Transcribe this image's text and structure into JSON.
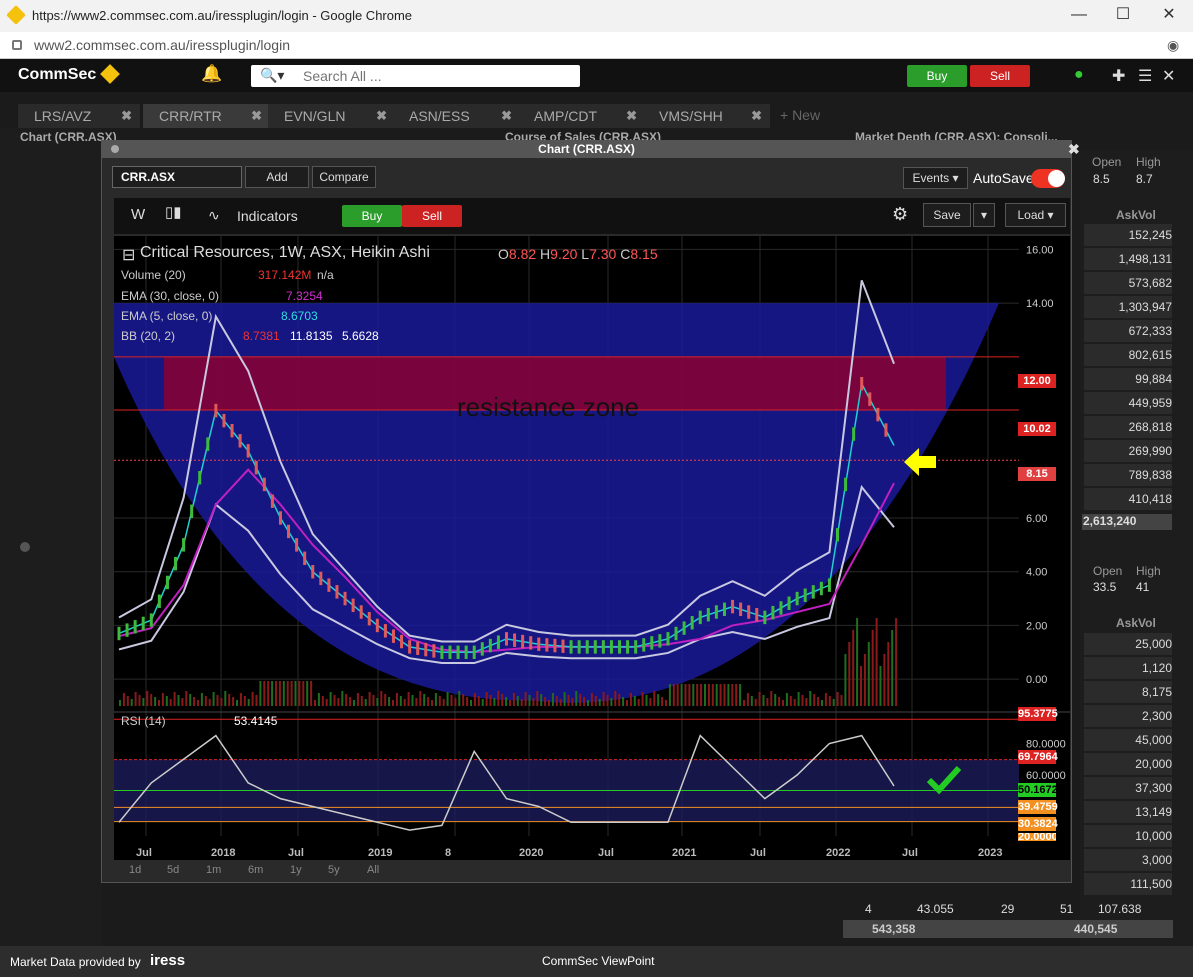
{
  "browser": {
    "title": "https://www2.commsec.com.au/iressplugin/login - Google Chrome",
    "url": "www2.commsec.com.au/iressplugin/login",
    "min_icon": "—",
    "max_icon": "☐",
    "close_icon": "✕"
  },
  "app": {
    "logo": "CommSec",
    "search_placeholder": "Search All ...",
    "buy": "Buy",
    "sell": "Sell",
    "footer_left": "Market Data provided by",
    "footer_brand": "iress",
    "footer_center": "CommSec ViewPoint"
  },
  "tabs": [
    {
      "label": "LRS/AVZ"
    },
    {
      "label": "CRR/RTR"
    },
    {
      "label": "EVN/GLN"
    },
    {
      "label": "ASN/ESS"
    },
    {
      "label": "AMP/CDT"
    },
    {
      "label": "VMS/SHH"
    }
  ],
  "new_tab": "+ New",
  "panels": {
    "chart_left": "Chart (CRR.ASX)",
    "course_of_sales": "Course of Sales (CRR.ASX)",
    "market_depth": "Market Depth (CRR.ASX): Consoli..."
  },
  "depth_top": {
    "open_label": "Open",
    "open": "8.5",
    "high_label": "High",
    "high": "8.7",
    "askvol_label": "AskVol",
    "askvols": [
      "152,245",
      "1,498,131",
      "573,682",
      "1,303,947",
      "672,333",
      "802,615",
      "99,884",
      "449,959",
      "268,818",
      "269,990",
      "789,838",
      "410,418"
    ],
    "total": "2,613,240"
  },
  "depth_bottom": {
    "open_label": "Open",
    "open": "33.5",
    "high_label": "High",
    "high": "41",
    "askvol_label": "AskVol",
    "askvols": [
      "25,000",
      "1,120",
      "8,175",
      "2,300",
      "45,000",
      "20,000",
      "37,300",
      "13,149",
      "10,000",
      "3,000",
      "111,500"
    ]
  },
  "bottom_row": {
    "a": "4",
    "b": "43.055",
    "c": "29",
    "d": "51",
    "e": "107.638",
    "f": "543,358",
    "g": "440,545"
  },
  "chart_window": {
    "title": "Chart (CRR.ASX)",
    "symbol": "CRR.ASX",
    "add": "Add",
    "compare": "Compare",
    "events": "Events ▾",
    "autosave": "AutoSave",
    "interval": "W",
    "indicators": "Indicators",
    "buy": "Buy",
    "sell": "Sell",
    "save": "Save",
    "load": "Load ▾"
  },
  "legend": {
    "title": "Critical Resources, 1W, ASX, Heikin Ashi",
    "o_label": "O",
    "o": "8.82",
    "h_label": "H",
    "h": "9.20",
    "l_label": "L",
    "l": "7.30",
    "c_label": "C",
    "c": "8.15",
    "volume": "Volume (20)",
    "volume_val": "317.142M",
    "volume_na": "n/a",
    "ema30": "EMA (30, close, 0)",
    "ema30_val": "7.3254",
    "ema5": "EMA (5, close, 0)",
    "ema5_val": "8.6703",
    "bb": "BB (20, 2)",
    "bb_v1": "8.7381",
    "bb_v2": "11.8135",
    "bb_v3": "5.6628",
    "rsi": "RSI (14)",
    "rsi_val": "53.4145"
  },
  "annotation": "resistance zone",
  "price_tags": {
    "p12": "12.00",
    "p10": "10.02",
    "p8": "8.15"
  },
  "rsi_tags": {
    "r95": "95.3775",
    "r69": "69.7964",
    "r50": "50.1672",
    "r39": "39.4759",
    "r30": "30.3824",
    "r20": "20.0000"
  },
  "periods": [
    "1d",
    "5d",
    "1m",
    "6m",
    "1y",
    "5y",
    "All"
  ],
  "colors": {
    "buy": "#2a9d2a",
    "sell": "#cc2222",
    "resistance": "#8b0030",
    "cup": "#1a1a9a",
    "ema30": "#c020c0",
    "ema5": "#20d0d0",
    "bb": "#c8c8e0",
    "up": "#3dbb3d",
    "down": "#e05a5a"
  },
  "chart_data": {
    "type": "line",
    "title": "Critical Resources, 1W, ASX, Heikin Ashi",
    "x_ticks": [
      "Jul",
      "2018",
      "Jul",
      "2019",
      "8",
      "2020",
      "Jul",
      "2021",
      "Jul",
      "2022",
      "Jul",
      "2023"
    ],
    "y_ticks": [
      0,
      2,
      4,
      6,
      14,
      16
    ],
    "ylim": [
      -1,
      16.5
    ],
    "resistance_zone": [
      10.02,
      12.0
    ],
    "last_close": 8.15,
    "series": [
      {
        "name": "EMA (30, close, 0)",
        "values": [
          1.6,
          1.9,
          3.5,
          6.5,
          7.8,
          6.5,
          5.0,
          3.8,
          2.5,
          1.5,
          1.1,
          1.0,
          1.1,
          1.2,
          1.2,
          1.2,
          1.2,
          1.3,
          1.5,
          2.0,
          2.2,
          2.5,
          2.8,
          5.0,
          7.3
        ]
      },
      {
        "name": "EMA (5, close, 0)",
        "values": [
          1.7,
          2.2,
          5.0,
          10.0,
          8.5,
          6.0,
          4.0,
          3.0,
          2.0,
          1.2,
          1.0,
          1.0,
          1.5,
          1.3,
          1.2,
          1.2,
          1.2,
          1.5,
          2.3,
          2.7,
          2.3,
          3.0,
          3.5,
          11.0,
          8.7
        ]
      },
      {
        "name": "RSI (14)",
        "values": [
          30,
          55,
          70,
          85,
          55,
          45,
          40,
          35,
          30,
          25,
          28,
          75,
          45,
          40,
          30,
          30,
          30,
          30,
          85,
          65,
          45,
          60,
          80,
          85,
          53
        ]
      }
    ],
    "rsi_ylim": [
      20,
      100
    ],
    "rsi_levels": [
      80,
      69.7964,
      60,
      50.1672,
      39.4759,
      30.3824
    ]
  }
}
